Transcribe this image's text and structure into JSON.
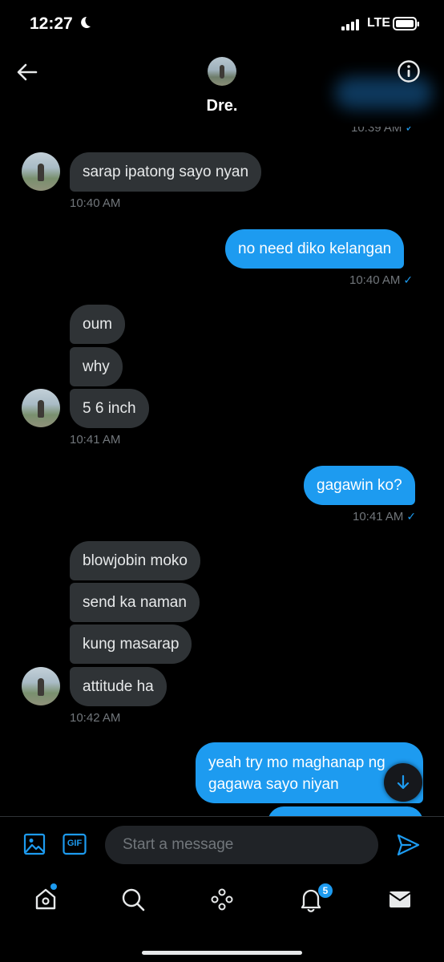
{
  "status_bar": {
    "time": "12:27",
    "carrier": "LTE"
  },
  "header": {
    "name": "Dre."
  },
  "partial_timestamp": "10:39 AM",
  "messages": [
    {
      "from": "them",
      "text": "sarap ipatong sayo nyan"
    },
    {
      "from": "them_time",
      "text": "10:40 AM"
    },
    {
      "from": "me",
      "text": "no need diko kelangan"
    },
    {
      "from": "me_time",
      "text": "10:40 AM"
    },
    {
      "from": "them",
      "text": "oum"
    },
    {
      "from": "them",
      "text": "why"
    },
    {
      "from": "them",
      "text": "5 6 inch"
    },
    {
      "from": "them_time",
      "text": "10:41 AM"
    },
    {
      "from": "me",
      "text": "gagawin ko?"
    },
    {
      "from": "me_time",
      "text": "10:41 AM"
    },
    {
      "from": "them",
      "text": "blowjobin moko"
    },
    {
      "from": "them",
      "text": "send ka naman"
    },
    {
      "from": "them",
      "text": "kung masarap"
    },
    {
      "from": "them",
      "text": "attitude ha"
    },
    {
      "from": "them_time",
      "text": "10:42 AM"
    },
    {
      "from": "me",
      "text": "yeah try mo maghanap ng"
    },
    {
      "from": "me",
      "text": "gagawa sayo niyan"
    }
  ],
  "composer": {
    "placeholder": "Start a message",
    "gif_label": "GIF"
  },
  "nav": {
    "items": [
      "home-icon",
      "search-icon",
      "spaces-icon",
      "notifications-icon",
      "messages-icon"
    ],
    "notification_count": "5"
  },
  "colors": {
    "accent": "#1d9bf0",
    "received_bubble": "#2f3336",
    "background": "#000000"
  }
}
